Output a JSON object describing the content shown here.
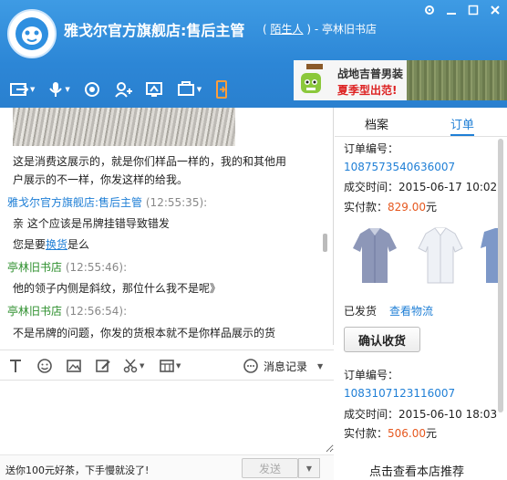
{
  "header": {
    "title": "雅戈尔官方旗舰店:售后主管",
    "relation": "陌生人",
    "relation_open": "(",
    "relation_close": ")",
    "separator": " - ",
    "peer": "亭林旧书店",
    "avatar_icon": "qq-avatar-icon"
  },
  "window_controls": [
    "gear-icon",
    "minimize-icon",
    "maximize-icon",
    "close-icon"
  ],
  "toolbar": [
    "transfer-file-icon",
    "voice-icon",
    "video-icon",
    "add-user-icon",
    "screen-share-icon",
    "remote-icon",
    "phone-icon"
  ],
  "banner": {
    "line1": "战地吉普男装",
    "line2": "夏季型出范!"
  },
  "messages": [
    {
      "type": "text",
      "text": "这是消费这展示的，就是你们样品一样的，我的和其他用"
    },
    {
      "type": "text",
      "text": "户展示的不一样，你发这样的给我。"
    },
    {
      "type": "sender",
      "name": "雅戈尔官方旗舰店:售后主管",
      "time": "(12:55:35):",
      "color": "#1f7fd6"
    },
    {
      "type": "text",
      "text": "亲 这个应该是吊牌挂错导致错发"
    },
    {
      "type": "text_link",
      "prefix": "您是要",
      "link": "换货",
      "suffix": "是么"
    },
    {
      "type": "sender",
      "name": "亭林旧书店",
      "time": "(12:55:46):",
      "color": "#2d8f2d"
    },
    {
      "type": "text",
      "text": "他的领子内侧是斜纹，那位什么我不是呢》"
    },
    {
      "type": "sender",
      "name": "亭林旧书店",
      "time": "(12:56:54):",
      "color": "#2d8f2d"
    },
    {
      "type": "text",
      "text": "不是吊牌的问题，你发的货根本就不是你样品展示的货"
    }
  ],
  "input_toolbar": {
    "icons": [
      "font-icon",
      "emoji-icon",
      "image-icon",
      "edit-icon",
      "scissors-icon",
      "calculator-icon"
    ],
    "history_label": "消息记录"
  },
  "bottom": {
    "promo": "送你100元好茶，下手慢就没了!",
    "send_label": "发送"
  },
  "right_panel": {
    "tabs": [
      "档案",
      "订单"
    ],
    "active_tab": "订单",
    "orders": [
      {
        "no_label": "订单编号：",
        "no": "1087573540636007",
        "time_label": "成交时间：",
        "time": "2015-06-17 10:02",
        "paid_label": "实付款：",
        "paid": "829.00",
        "paid_unit": "元",
        "status": "已发货",
        "logistics": "查看物流",
        "confirm": "确认收货"
      },
      {
        "no_label": "订单编号：",
        "no": "1083107123116007",
        "time_label": "成交时间：",
        "time": "2015-06-10 18:03",
        "paid_label": "实付款：",
        "paid": "506.00",
        "paid_unit": "元"
      }
    ],
    "footer": "点击查看本店推荐"
  },
  "colors": {
    "header_blue": "#2c86d6",
    "link_blue": "#1f7fd6",
    "price_orange": "#e6581f",
    "sender_green": "#2d8f2d"
  }
}
